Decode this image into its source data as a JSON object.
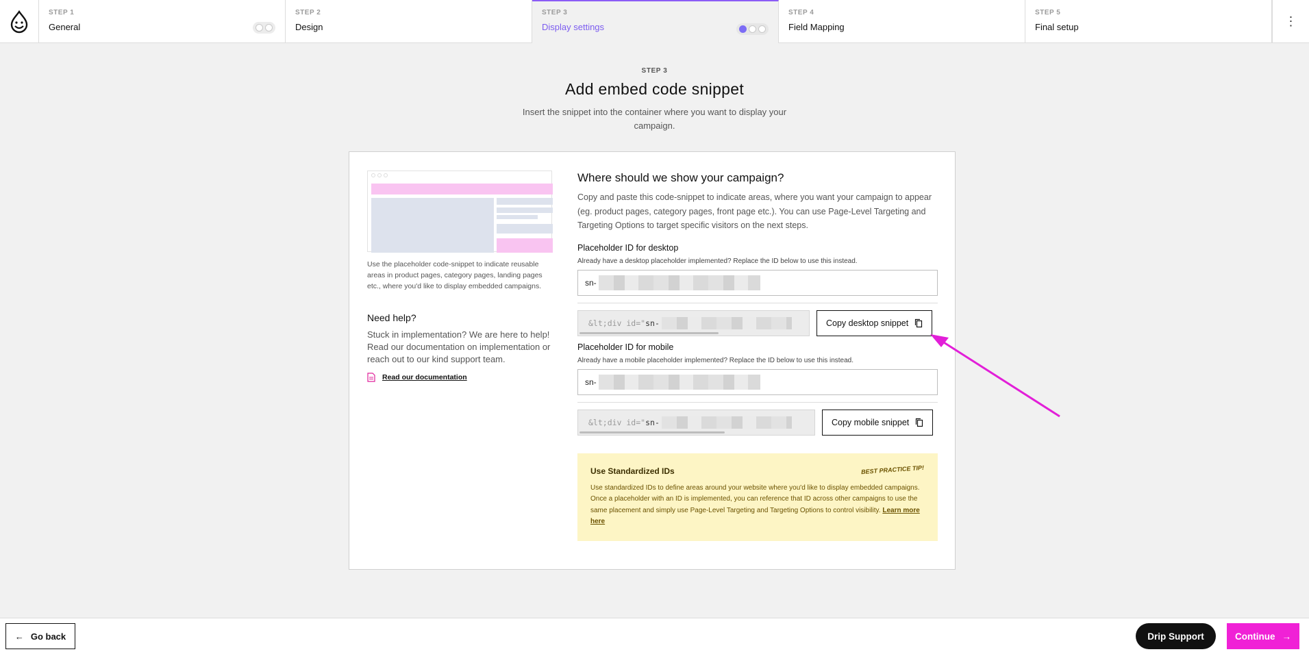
{
  "steps": [
    {
      "num": "STEP 1",
      "name": "General"
    },
    {
      "num": "STEP 2",
      "name": "Design"
    },
    {
      "num": "STEP 3",
      "name": "Display settings"
    },
    {
      "num": "STEP 4",
      "name": "Field Mapping"
    },
    {
      "num": "STEP 5",
      "name": "Final setup"
    }
  ],
  "header": {
    "kicker": "STEP 3",
    "title": "Add embed code snippet",
    "subtitle": "Insert the snippet into the container where you want to display your campaign."
  },
  "left": {
    "caption": "Use the placeholder code-snippet to indicate reusable areas in product pages, category pages, landing pages etc., where you'd like to display embedded campaigns.",
    "help_title": "Need help?",
    "help_text": "Stuck in implementation? We are here to help! Read our documentation on implementation or reach out to our kind support team.",
    "doc_link": "Read our documentation"
  },
  "right": {
    "title": "Where should we show your campaign?",
    "intro": "Copy and paste this code-snippet to indicate areas, where you want your campaign to appear (eg. product pages, category pages, front page etc.). You can use Page-Level Targeting and Targeting Options to target specific visitors on the next steps.",
    "desktop": {
      "label": "Placeholder ID for desktop",
      "sublabel": "Already have a desktop placeholder implemented? Replace the ID below to use this instead.",
      "id_prefix": "sn-",
      "snippet_prefix": "&lt;div id=\"",
      "snippet_id": "sn-",
      "copy_label": "Copy desktop snippet"
    },
    "mobile": {
      "label": "Placeholder ID for mobile",
      "sublabel": "Already have a mobile placeholder implemented? Replace the ID below to use this instead.",
      "id_prefix": "sn-",
      "snippet_prefix": "&lt;div id=\"",
      "snippet_id": "sn-",
      "copy_label": "Copy mobile snippet"
    },
    "tip": {
      "title": "Use Standardized IDs",
      "badge": "BEST PRACTICE TIP!",
      "text": "Use standardized IDs to define areas around your website where you'd like to display embedded campaigns. Once a placeholder with an ID is implemented, you can reference that ID across other campaigns to use the same placement and simply use Page-Level Targeting and Targeting Options to control visibility.",
      "link": "Learn more here"
    }
  },
  "footer": {
    "back_label": "Go back",
    "support_label": "Drip Support",
    "continue_label": "Continue"
  },
  "colors": {
    "accent_purple": "#7c5cf0",
    "brand_pink": "#f021d6",
    "tip_bg": "#fdf5c5"
  }
}
